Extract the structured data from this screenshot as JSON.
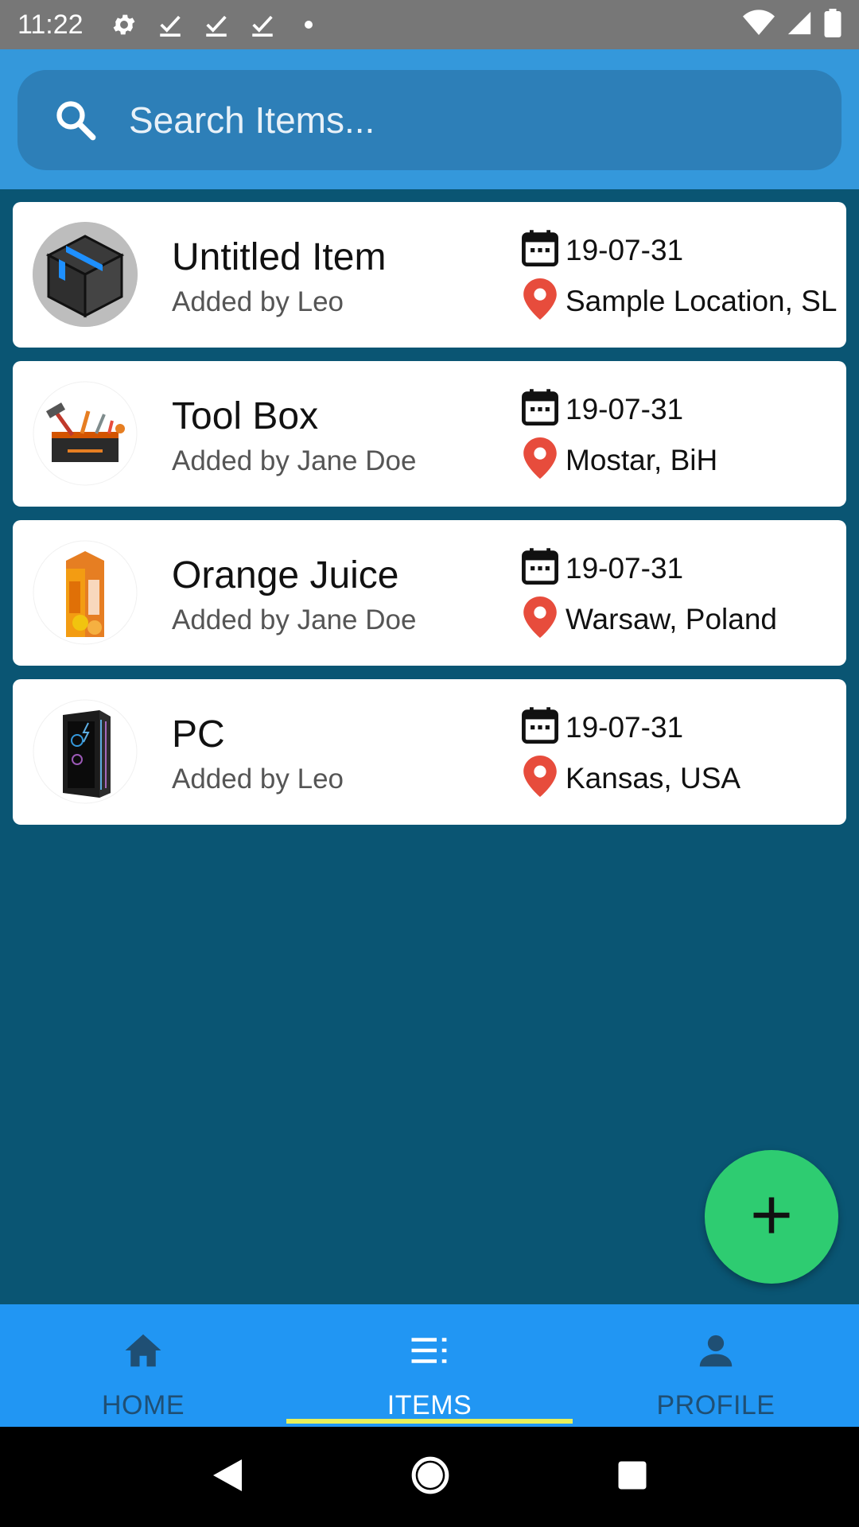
{
  "status_bar": {
    "time": "11:22"
  },
  "search": {
    "placeholder": "Search Items..."
  },
  "items": [
    {
      "title": "Untitled Item",
      "added_by": "Added by Leo",
      "date": "19-07-31",
      "location": "Sample Location, SL",
      "image": "box-icon"
    },
    {
      "title": "Tool Box",
      "added_by": "Added by Jane Doe",
      "date": "19-07-31",
      "location": "Mostar, BiH",
      "image": "toolbox-image"
    },
    {
      "title": "Orange Juice",
      "added_by": "Added by Jane Doe",
      "date": "19-07-31",
      "location": "Warsaw, Poland",
      "image": "orange-juice-image"
    },
    {
      "title": "PC",
      "added_by": "Added by Leo",
      "date": "19-07-31",
      "location": "Kansas, USA",
      "image": "pc-image"
    }
  ],
  "bottom_nav": {
    "home": "HOME",
    "items": "ITEMS",
    "profile": "PROFILE",
    "active": "items"
  },
  "colors": {
    "header": "#3498db",
    "background": "#0a5573",
    "fab": "#2ecc71",
    "nav": "#2196f3",
    "indicator": "#e9f05a",
    "pin": "#e74c3c"
  }
}
